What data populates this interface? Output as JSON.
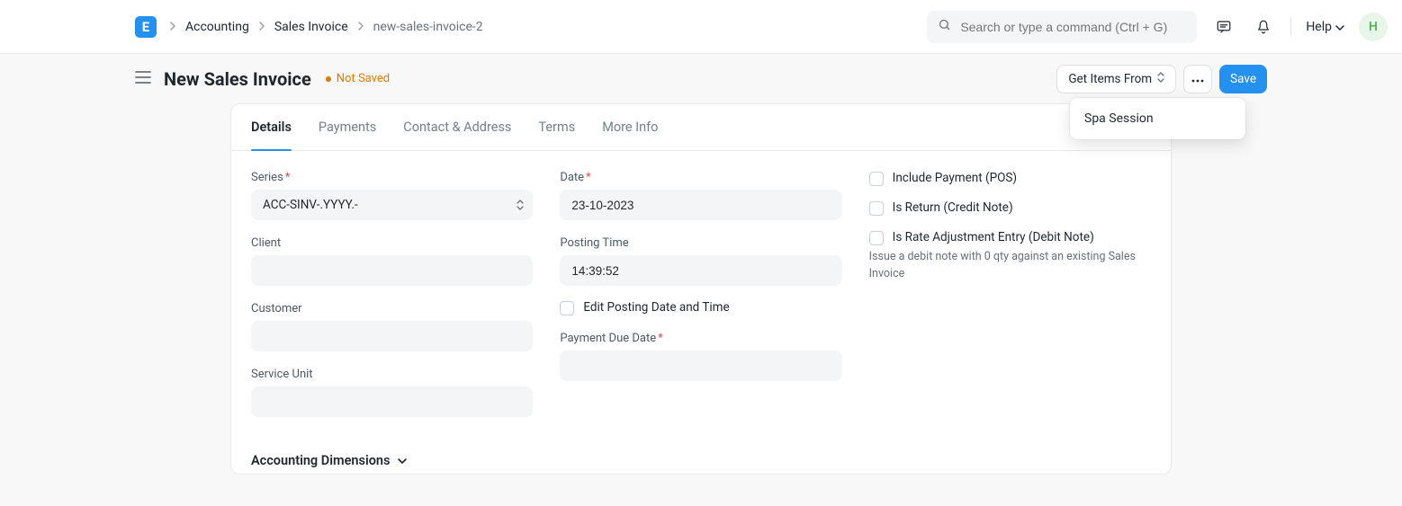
{
  "navbar": {
    "logo_letter": "E",
    "breadcrumbs": [
      "Accounting",
      "Sales Invoice",
      "new-sales-invoice-2"
    ],
    "search_placeholder": "Search or type a command (Ctrl + G)",
    "help_label": "Help",
    "avatar_letter": "H"
  },
  "header": {
    "title": "New Sales Invoice",
    "status": "Not Saved",
    "get_items_label": "Get Items From",
    "save_label": "Save",
    "dropdown_items": [
      "Spa Session"
    ]
  },
  "tabs": [
    "Details",
    "Payments",
    "Contact & Address",
    "Terms",
    "More Info"
  ],
  "form": {
    "col1": {
      "series_label": "Series",
      "series_value": "ACC-SINV-.YYYY.-",
      "client_label": "Client",
      "client_value": "",
      "customer_label": "Customer",
      "customer_value": "",
      "service_unit_label": "Service Unit",
      "service_unit_value": ""
    },
    "col2": {
      "date_label": "Date",
      "date_value": "23-10-2023",
      "posting_time_label": "Posting Time",
      "posting_time_value": "14:39:52",
      "edit_posting_label": "Edit Posting Date and Time",
      "payment_due_date_label": "Payment Due Date",
      "payment_due_date_value": ""
    },
    "col3": {
      "include_payment_label": "Include Payment (POS)",
      "is_return_label": "Is Return (Credit Note)",
      "is_rate_adj_label": "Is Rate Adjustment Entry (Debit Note)",
      "is_rate_adj_desc": "Issue a debit note with 0 qty against an existing Sales Invoice"
    }
  },
  "section": {
    "accounting_dimensions": "Accounting Dimensions"
  }
}
